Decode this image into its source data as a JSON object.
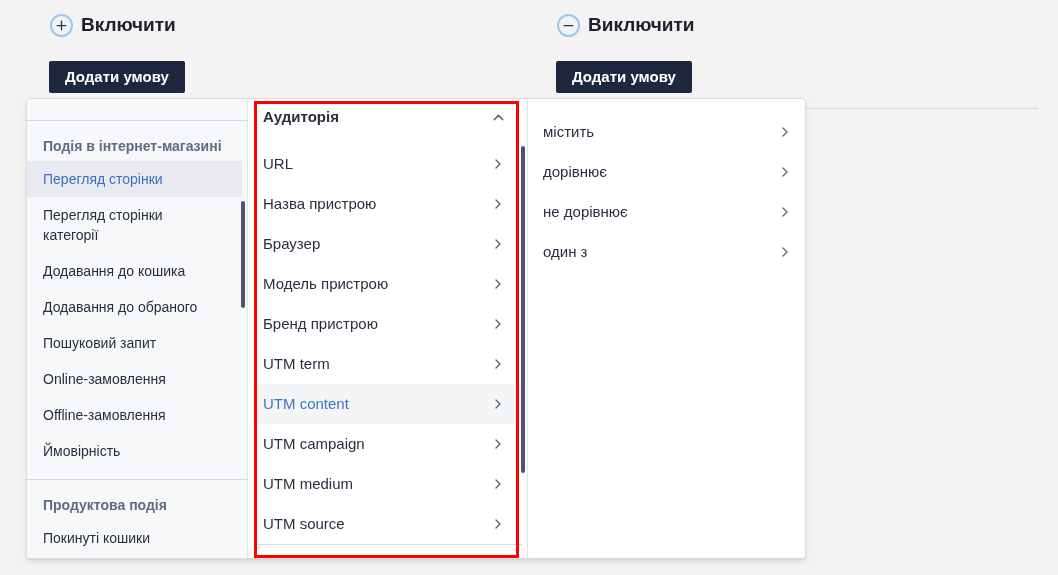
{
  "sections": [
    {
      "title": "Включити",
      "kind": "include",
      "button": "Додати умову"
    },
    {
      "title": "Виключити",
      "kind": "exclude",
      "button": "Додати умову"
    }
  ],
  "dropdown": {
    "groups": [
      {
        "heading": "Подія в інтернет-магазині",
        "items": [
          {
            "label": "Перегляд сторінки",
            "selected": true
          },
          {
            "label": "Перегляд сторінки категорії",
            "selected": false
          },
          {
            "label": "Додавання до кошика",
            "selected": false
          },
          {
            "label": "Додавання до обраного",
            "selected": false
          },
          {
            "label": "Пошуковий запит",
            "selected": false
          },
          {
            "label": "Online-замовлення",
            "selected": false
          },
          {
            "label": "Offline-замовлення",
            "selected": false
          },
          {
            "label": "Ймовірність",
            "selected": false
          }
        ]
      },
      {
        "heading": "Продуктова подія",
        "items": [
          {
            "label": "Покинуті кошики",
            "selected": false
          }
        ]
      }
    ],
    "attributes": {
      "heading": "Аудиторія",
      "expanded": true,
      "items": [
        {
          "label": "URL",
          "selected": false
        },
        {
          "label": "Назва пристрою",
          "selected": false
        },
        {
          "label": "Браузер",
          "selected": false
        },
        {
          "label": "Модель пристрою",
          "selected": false
        },
        {
          "label": "Бренд пристрою",
          "selected": false
        },
        {
          "label": "UTM term",
          "selected": false
        },
        {
          "label": "UTM content",
          "selected": true
        },
        {
          "label": "UTM campaign",
          "selected": false
        },
        {
          "label": "UTM medium",
          "selected": false
        },
        {
          "label": "UTM source",
          "selected": false
        }
      ]
    },
    "operators": [
      {
        "label": "містить"
      },
      {
        "label": "дорівнює"
      },
      {
        "label": "не дорівнює"
      },
      {
        "label": "один з"
      }
    ]
  }
}
